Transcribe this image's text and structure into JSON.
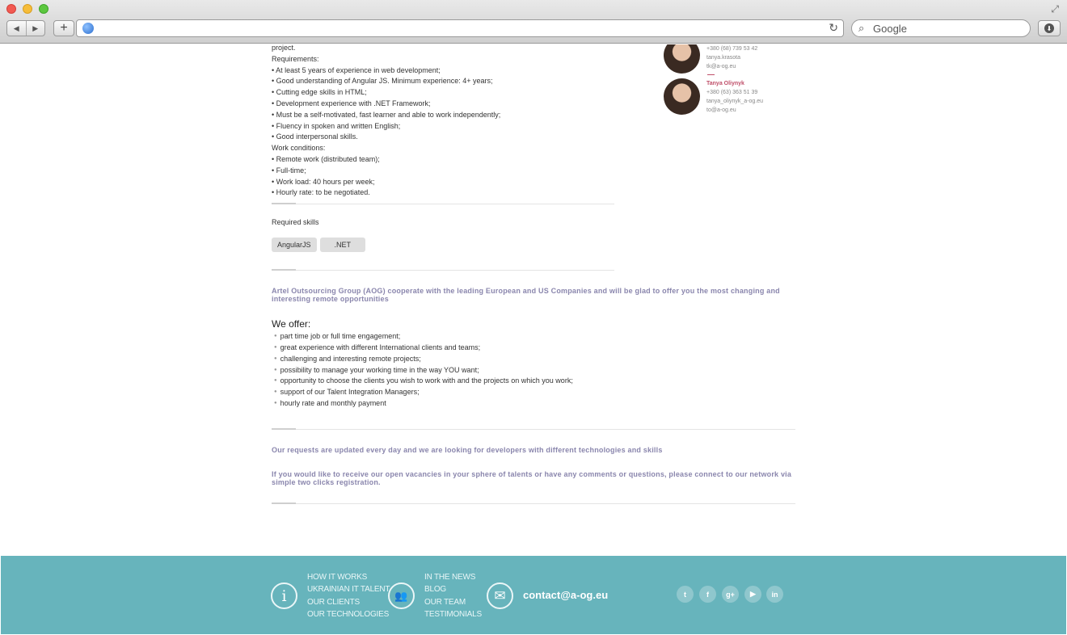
{
  "browser": {
    "search_placeholder": "Google",
    "nav_back": "◀",
    "nav_forward": "▶",
    "new_tab": "+",
    "reload": "↻",
    "search_icon": "magnifier-icon",
    "download": "⬇",
    "fullscreen": "⤢"
  },
  "contacts": [
    {
      "name": "",
      "phone": "+380 (68) 739 53 42",
      "skype": "tanya.krasota",
      "email": "tk@a-og.eu"
    },
    {
      "name": "Tanya Oliynyk",
      "phone": "+380 (63) 363 51 39",
      "skype": "tanya_oliynyk_a-og.eu",
      "email": "to@a-og.eu"
    }
  ],
  "job": {
    "lines": [
      "project.",
      "Requirements:",
      "• At least 5 years of experience in web development;",
      "• Good understanding of Angular JS. Minimum experience: 4+ years;",
      "• Cutting edge skills in HTML;",
      "• Development experience with .NET Framework;",
      "• Must be a self-motivated, fast learner and able to work independently;",
      "• Fluency in spoken and written English;",
      "• Good interpersonal skills.",
      "Work conditions:",
      "• Remote work (distributed team);",
      "• Full-time;",
      "• Work load: 40 hours per week;",
      "• Hourly rate: to be negotiated."
    ],
    "required_skills_title": "Required skills",
    "skills": [
      "AngularJS",
      ".NET"
    ]
  },
  "intro_text": "Artel Outsourcing Group (AOG) cooperate with the leading European and US Companies and will be glad to offer you the most changing and interesting remote opportunities",
  "offer": {
    "title": "We offer:",
    "items": [
      "part time job or full time engagement;",
      "great experience with different International clients and teams;",
      "challenging and interesting remote projects;",
      "possibility to manage your working time in the way YOU want;",
      "opportunity to choose the clients you wish to work with and the projects on which you work;",
      "support of our Talent Integration Managers;",
      "hourly rate and monthly payment"
    ]
  },
  "updates_text": "Our requests are updated every day and we are looking for developers with different technologies and skills",
  "connect_text": "If you would like to receive our open vacancies in your sphere of talents or have any comments or questions, please connect to our network via simple two clicks registration.",
  "footer": {
    "col1": [
      "HOW IT WORKS",
      "UKRAINIAN IT TALENT",
      "OUR CLIENTS",
      "OUR TECHNOLOGIES"
    ],
    "col2": [
      "IN THE NEWS",
      "BLOG",
      "OUR TEAM",
      "TESTIMONIALS"
    ],
    "email": "contact@a-og.eu",
    "icons": {
      "info": "i",
      "team": "👥",
      "mail": "✉"
    },
    "social": [
      {
        "name": "twitter-icon",
        "glyph": "t"
      },
      {
        "name": "facebook-icon",
        "glyph": "f"
      },
      {
        "name": "google-plus-icon",
        "glyph": "g+"
      },
      {
        "name": "youtube-icon",
        "glyph": "▶"
      },
      {
        "name": "linkedin-icon",
        "glyph": "in"
      }
    ]
  },
  "colors": {
    "footer_bg": "#67b4bc",
    "accent_purple": "#8a86ad",
    "contact_name": "#c0506a"
  }
}
